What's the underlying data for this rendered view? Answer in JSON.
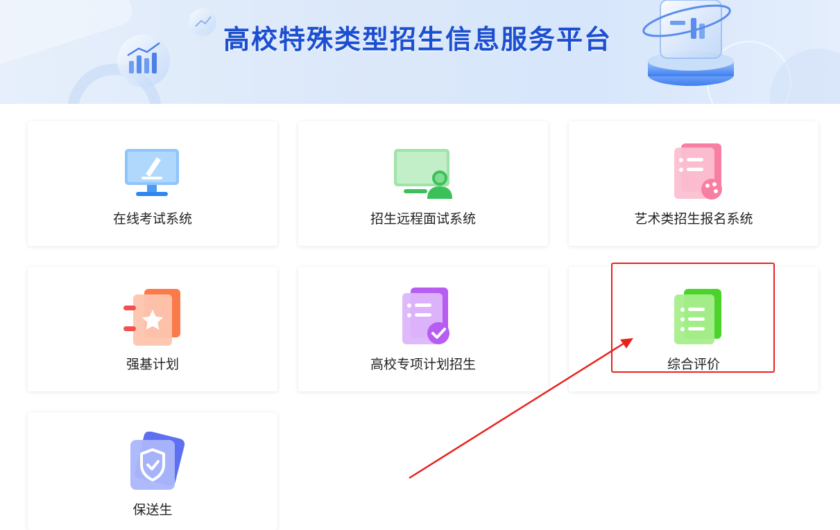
{
  "banner": {
    "title": "高校特殊类型招生信息服务平台"
  },
  "cards": [
    {
      "label": "在线考试系统",
      "icon": "online-exam-monitor-icon"
    },
    {
      "label": "招生远程面试系统",
      "icon": "remote-interview-screen-icon"
    },
    {
      "label": "艺术类招生报名系统",
      "icon": "art-palette-document-icon"
    },
    {
      "label": "强基计划",
      "icon": "star-notebook-icon"
    },
    {
      "label": "高校专项计划招生",
      "icon": "checked-document-icon"
    },
    {
      "label": "综合评价",
      "icon": "list-document-icon"
    },
    {
      "label": "保送生",
      "icon": "shield-check-icon"
    }
  ],
  "colors": {
    "banner_title": "#1c4fd0",
    "highlight": "#e8211d"
  }
}
